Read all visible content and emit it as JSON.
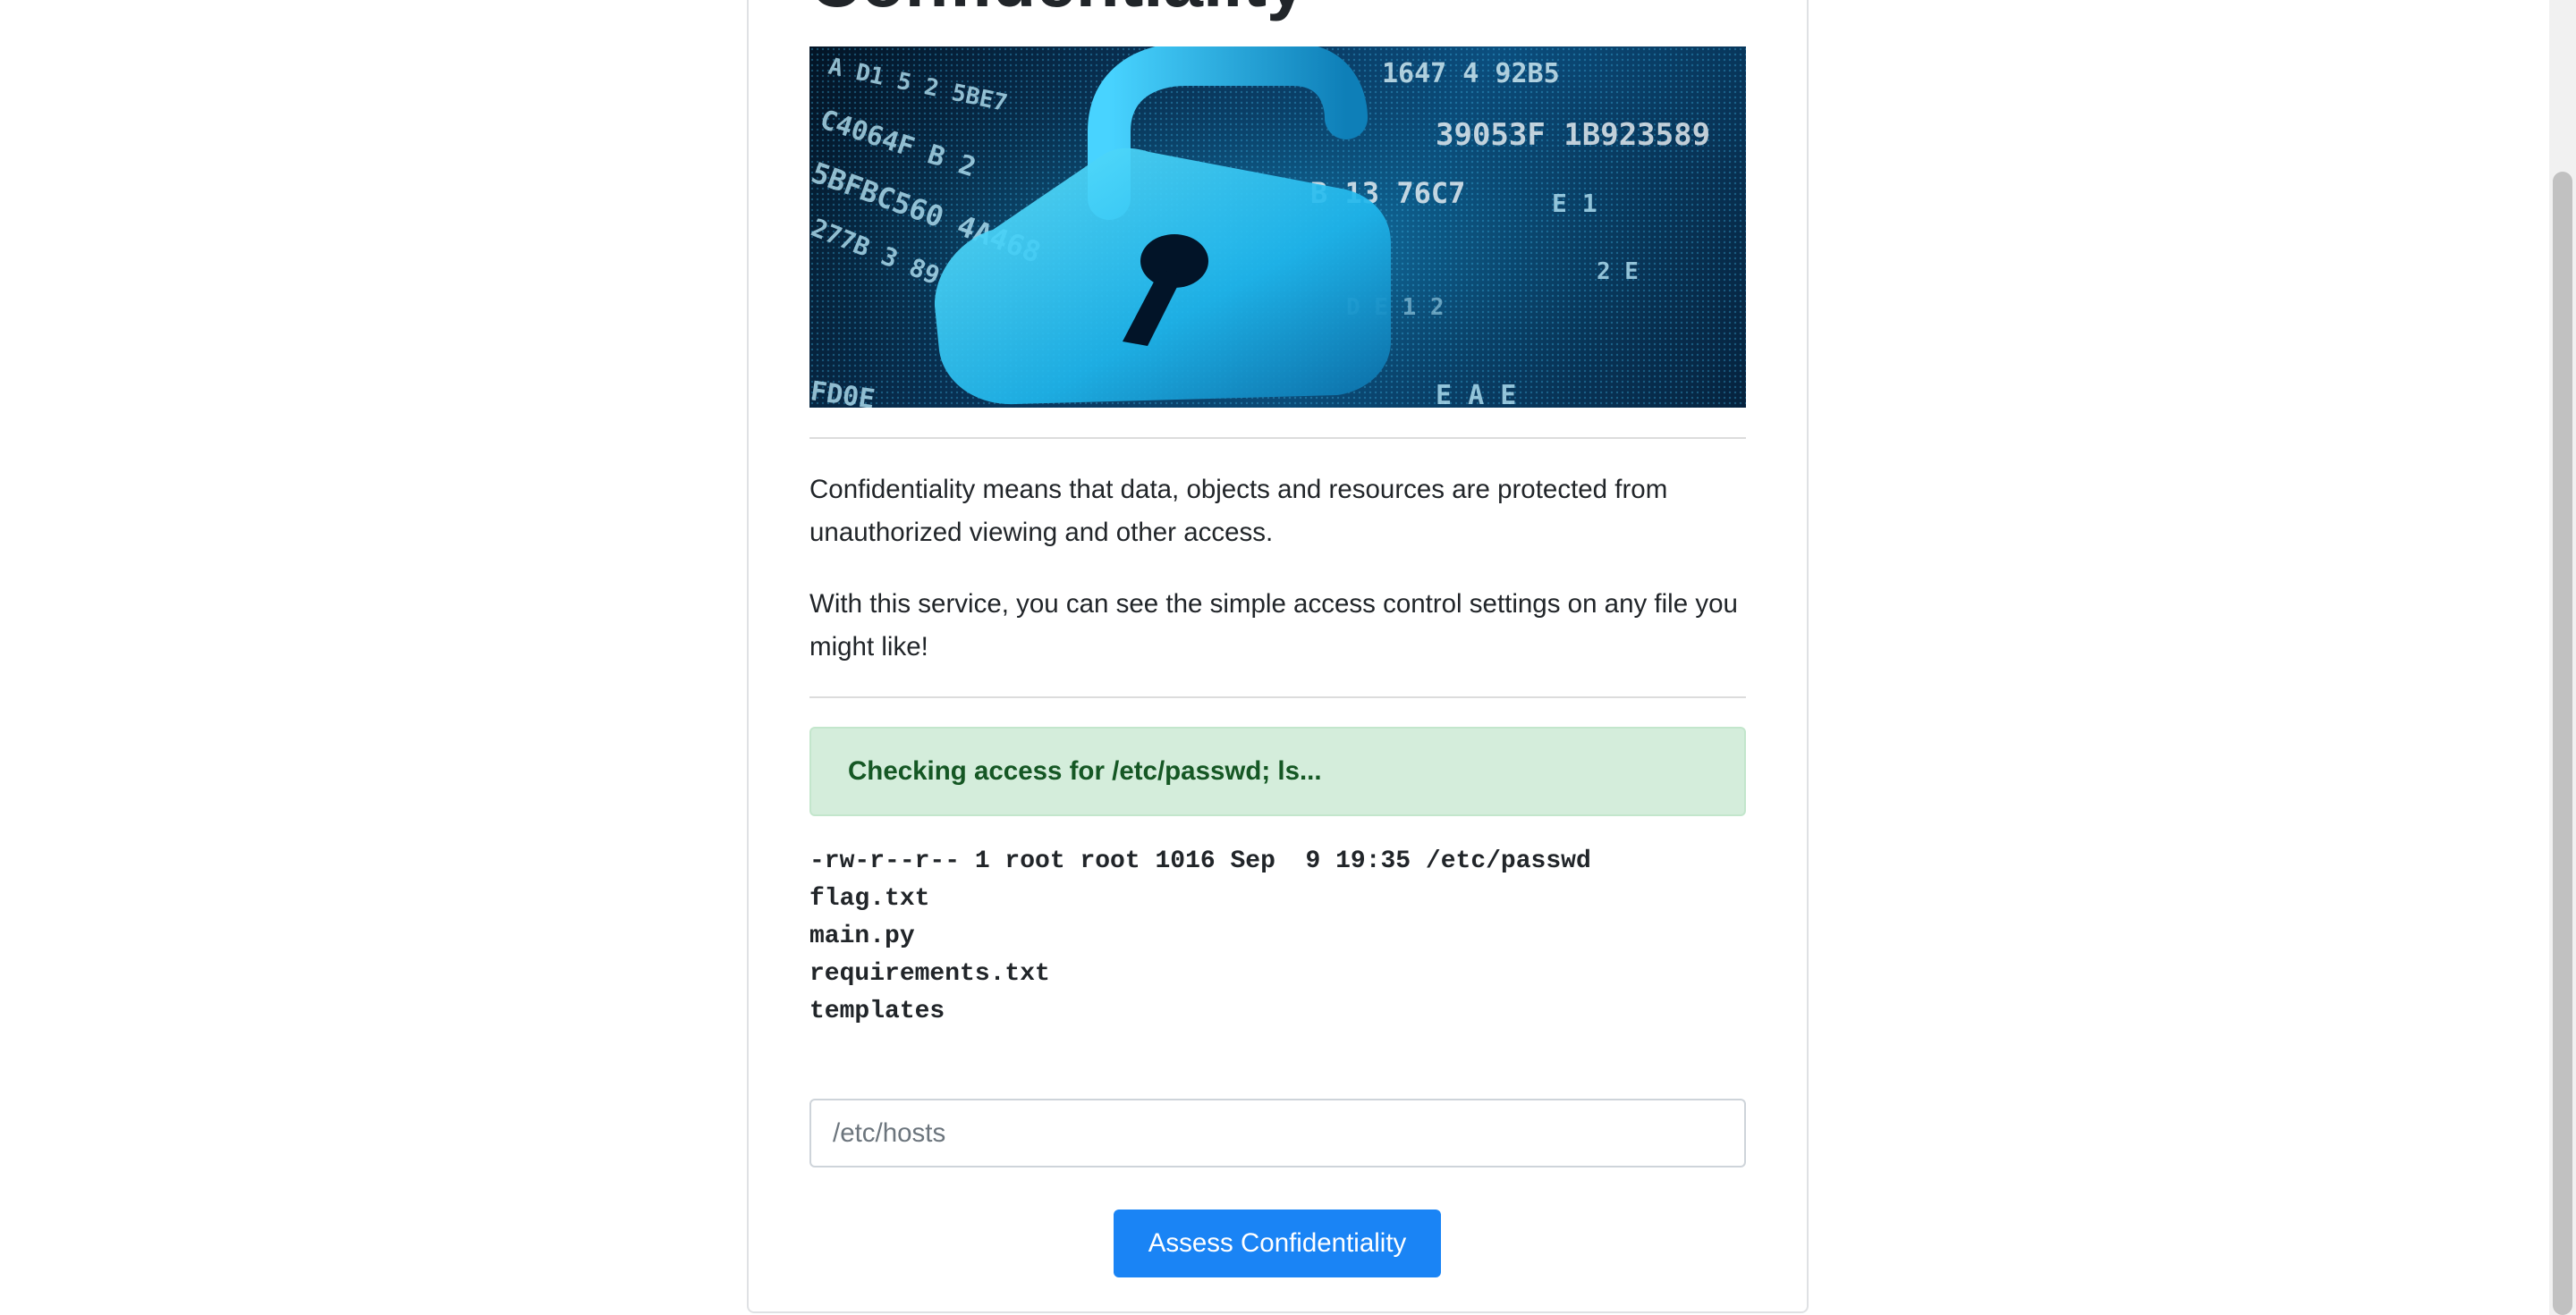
{
  "page": {
    "title": "Confidentiality",
    "hero_image": "unlocked-padlock-over-hex-data-image"
  },
  "intro": {
    "paragraph1": "Confidentiality means that data, objects and resources are protected from unauthorized viewing and other access.",
    "paragraph2": "With this service, you can see the simple access control settings on any file you might like!"
  },
  "alert": {
    "text": "Checking access for /etc/passwd; ls...",
    "color": "#155724",
    "background": "#d4eddb"
  },
  "output": {
    "lines": [
      "-rw-r--r-- 1 root root 1016 Sep  9 19:35 /etc/passwd",
      "flag.txt",
      "main.py",
      "requirements.txt",
      "templates"
    ]
  },
  "form": {
    "file_input_value": "",
    "file_input_placeholder": "/etc/hosts",
    "submit_label": "Assess Confidentiality",
    "submit_color": "#1a84f5"
  }
}
